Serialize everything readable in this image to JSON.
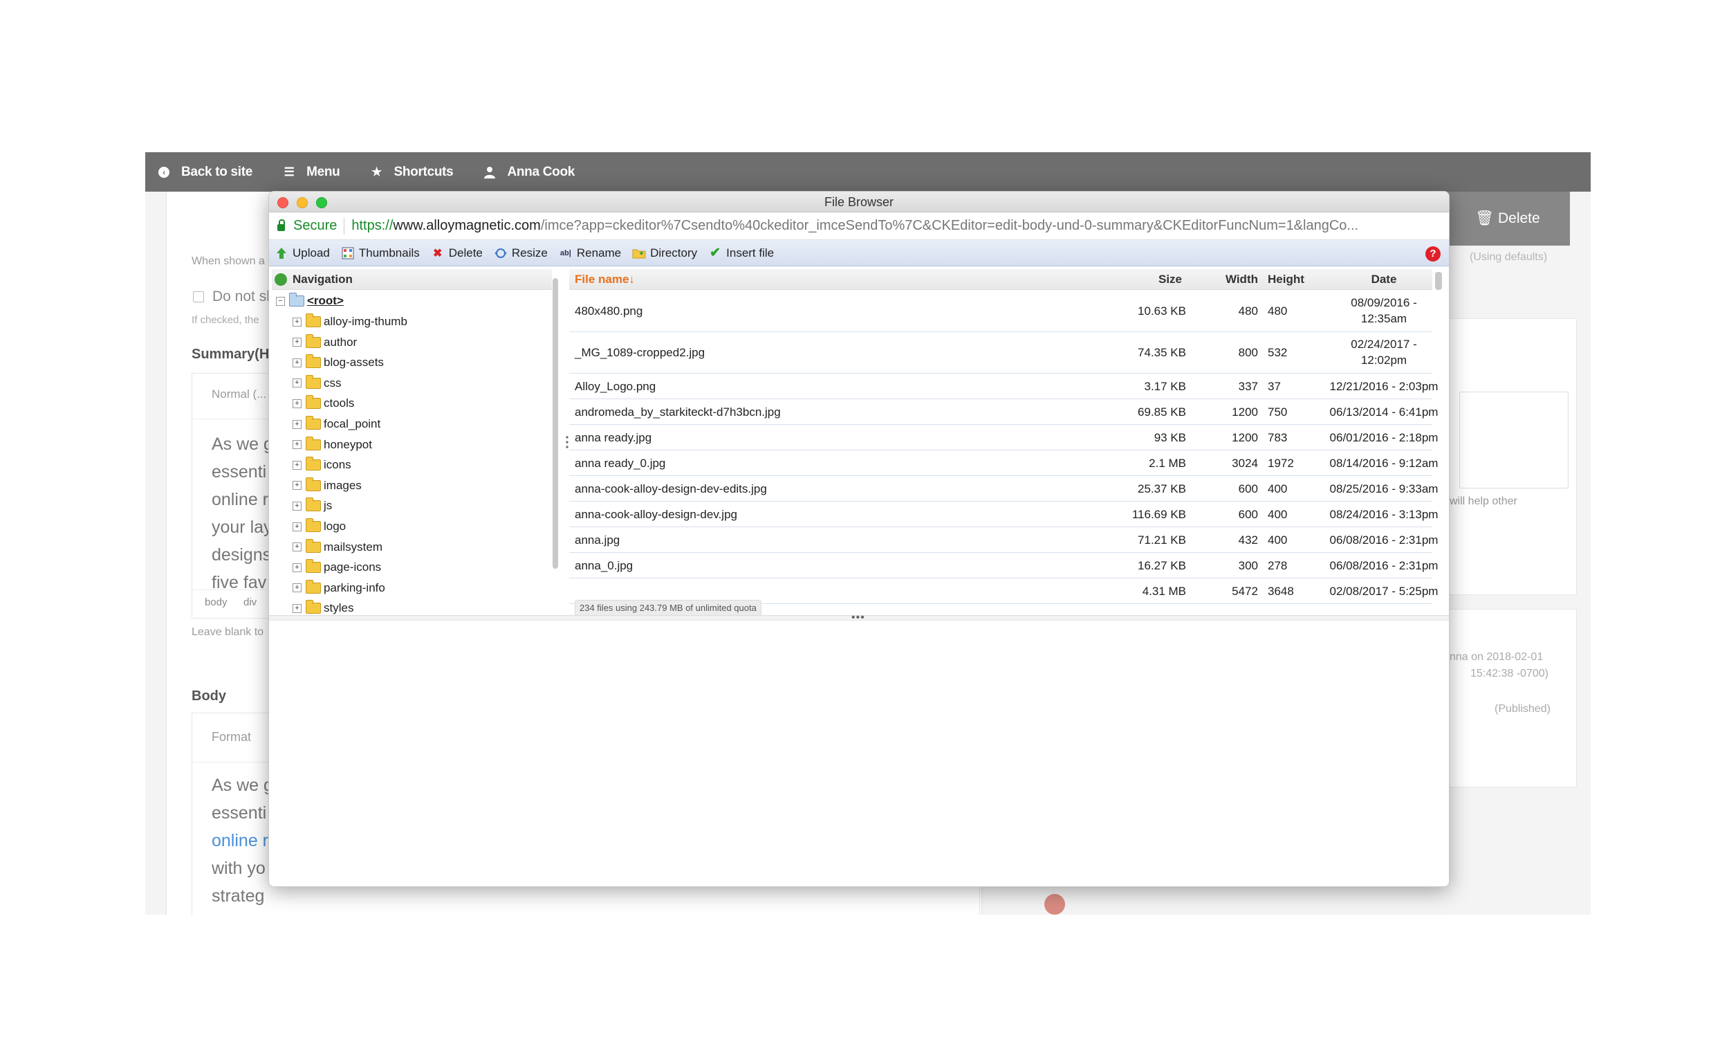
{
  "site": {
    "toolbar": {
      "back_label": "Back to site",
      "menu_label": "Menu",
      "shortcuts_label": "Shortcuts",
      "user_label": "Anna Cook"
    },
    "left_form": {
      "when_shown": "When shown a",
      "do_not_checkbox": "Do not sh",
      "if_checked": "If checked, the",
      "summary_label": "Summary(H",
      "format_normal": "Normal (...",
      "summary_prose": [
        "As we g",
        "essenti",
        "online r",
        "your lay",
        "designs",
        "five fav"
      ],
      "path_body": "body",
      "path_div": "div",
      "leave_blank": "Leave blank to",
      "body_label": "Body",
      "format_label": "Format",
      "body_prose": [
        "As we g",
        "essenti",
        "online r",
        "with yo",
        "strateg"
      ]
    },
    "right_col": {
      "delete_label": "Delete",
      "using_defaults": "(Using defaults)",
      "help_other": "will help other",
      "revision_line1": "nna on 2018-02-01",
      "revision_line2": "15:42:38 -0700)",
      "published": "(Published)"
    }
  },
  "modal": {
    "title": "File Browser",
    "secure_label": "Secure",
    "url_scheme": "https://",
    "url_domain": "www.alloymagnetic.com",
    "url_rest": "/imce?app=ckeditor%7Csendto%40ckeditor_imceSendTo%7C&CKEditor=edit-body-und-0-summary&CKEditorFuncNum=1&langCo...",
    "ops": {
      "upload": "Upload",
      "thumbnails": "Thumbnails",
      "delete": "Delete",
      "resize": "Resize",
      "rename": "Rename",
      "directory": "Directory",
      "insert": "Insert file"
    },
    "help_glyph": "?",
    "nav": {
      "header": "Navigation",
      "root": "<root>",
      "folders": [
        "alloy-img-thumb",
        "author",
        "blog-assets",
        "css",
        "ctools",
        "focal_point",
        "honeypot",
        "icons",
        "images",
        "js",
        "logo",
        "mailsystem",
        "page-icons",
        "parking-info",
        "styles"
      ]
    },
    "files": {
      "headers": {
        "name": "File name↓",
        "size": "Size",
        "width": "Width",
        "height": "Height",
        "date": "Date"
      },
      "rows": [
        {
          "name": "480x480.png",
          "size": "10.63 KB",
          "width": "480",
          "height": "480",
          "date1": "08/09/2016 -",
          "date2": "12:35am"
        },
        {
          "name": "_MG_1089-cropped2.jpg",
          "size": "74.35 KB",
          "width": "800",
          "height": "532",
          "date1": "02/24/2017 -",
          "date2": "12:02pm"
        },
        {
          "name": "Alloy_Logo.png",
          "size": "3.17 KB",
          "width": "337",
          "height": "37",
          "date1": "12/21/2016 - 2:03pm",
          "date2": ""
        },
        {
          "name": "andromeda_by_starkiteckt-d7h3bcn.jpg",
          "size": "69.85 KB",
          "width": "1200",
          "height": "750",
          "date1": "06/13/2014 - 6:41pm",
          "date2": ""
        },
        {
          "name": "anna ready.jpg",
          "size": "93 KB",
          "width": "1200",
          "height": "783",
          "date1": "06/01/2016 - 2:18pm",
          "date2": ""
        },
        {
          "name": "anna ready_0.jpg",
          "size": "2.1 MB",
          "width": "3024",
          "height": "1972",
          "date1": "08/14/2016 - 9:12am",
          "date2": ""
        },
        {
          "name": "anna-cook-alloy-design-dev-edits.jpg",
          "size": "25.37 KB",
          "width": "600",
          "height": "400",
          "date1": "08/25/2016 - 9:33am",
          "date2": ""
        },
        {
          "name": "anna-cook-alloy-design-dev.jpg",
          "size": "116.69 KB",
          "width": "600",
          "height": "400",
          "date1": "08/24/2016 - 3:13pm",
          "date2": ""
        },
        {
          "name": "anna.jpg",
          "size": "71.21 KB",
          "width": "432",
          "height": "400",
          "date1": "06/08/2016 - 2:31pm",
          "date2": ""
        },
        {
          "name": "anna_0.jpg",
          "size": "16.27 KB",
          "width": "300",
          "height": "278",
          "date1": "06/08/2016 - 2:31pm",
          "date2": ""
        },
        {
          "name": "",
          "size": "4.31 MB",
          "width": "5472",
          "height": "3648",
          "date1": "02/08/2017 - 5:25pm",
          "date2": ""
        }
      ],
      "status": "234 files using 243.79 MB of unlimited quota"
    },
    "splitter_grip": "•••"
  },
  "colors": {
    "toolbar_bg": "#6e6e6e",
    "secure_green": "#1a8a2a",
    "sort_orange": "#e8711c",
    "help_red": "#e0202a",
    "link_blue": "#4a90d9"
  }
}
